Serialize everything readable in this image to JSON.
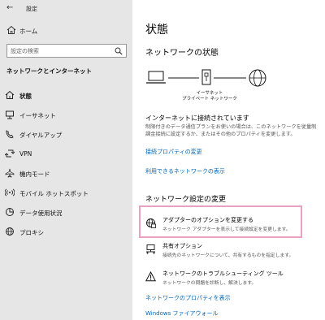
{
  "window": {
    "title": "設定"
  },
  "sidebar": {
    "home_label": "ホーム",
    "search_placeholder": "設定の検索",
    "section_title": "ネットワークとインターネット",
    "items": [
      {
        "label": "状態",
        "icon": "home-network-icon"
      },
      {
        "label": "イーサネット",
        "icon": "ethernet-icon"
      },
      {
        "label": "ダイヤルアップ",
        "icon": "dialup-phone-icon"
      },
      {
        "label": "VPN",
        "icon": "vpn-icon"
      },
      {
        "label": "機内モード",
        "icon": "airplane-icon"
      },
      {
        "label": "モバイル ホットスポット",
        "icon": "hotspot-icon"
      },
      {
        "label": "データ使用状況",
        "icon": "data-usage-icon"
      },
      {
        "label": "プロキシ",
        "icon": "globe-icon"
      }
    ]
  },
  "main": {
    "title": "状態",
    "network_status_heading": "ネットワークの状態",
    "diagram_caption_line1": "イーサネット",
    "diagram_caption_line2": "プライベート ネットワーク",
    "status_main": "インターネットに接続されています",
    "status_desc": "制限付きのデータ通信プランをお使いの場合は、このネットワークを従量制課金接続に設定するか、またはその他のプロパティを変更します。",
    "link_connection_props": "接続プロパティの変更",
    "link_available_networks": "利用できるネットワークの表示",
    "change_settings_heading": "ネットワーク設定の変更",
    "options": [
      {
        "title": "アダプターのオプションを変更する",
        "desc": "ネットワーク アダプターを表示して接続設定を変更します。",
        "icon": "adapter-globe-icon"
      },
      {
        "title": "共有オプション",
        "desc": "接続先のネットワークについて、共有するものを指定します。",
        "icon": "sharing-icon"
      },
      {
        "title": "ネットワークのトラブルシューティング ツール",
        "desc": "ネットワークの問題を診断し、解決します。",
        "icon": "warning-icon"
      }
    ],
    "link_network_props": "ネットワークのプロパティを表示",
    "link_firewall": "Windows ファイアウォール"
  },
  "colors": {
    "accent": "#0067b8",
    "highlight": "#e9a0c2",
    "sidebar_bg": "#e6e6e6"
  }
}
